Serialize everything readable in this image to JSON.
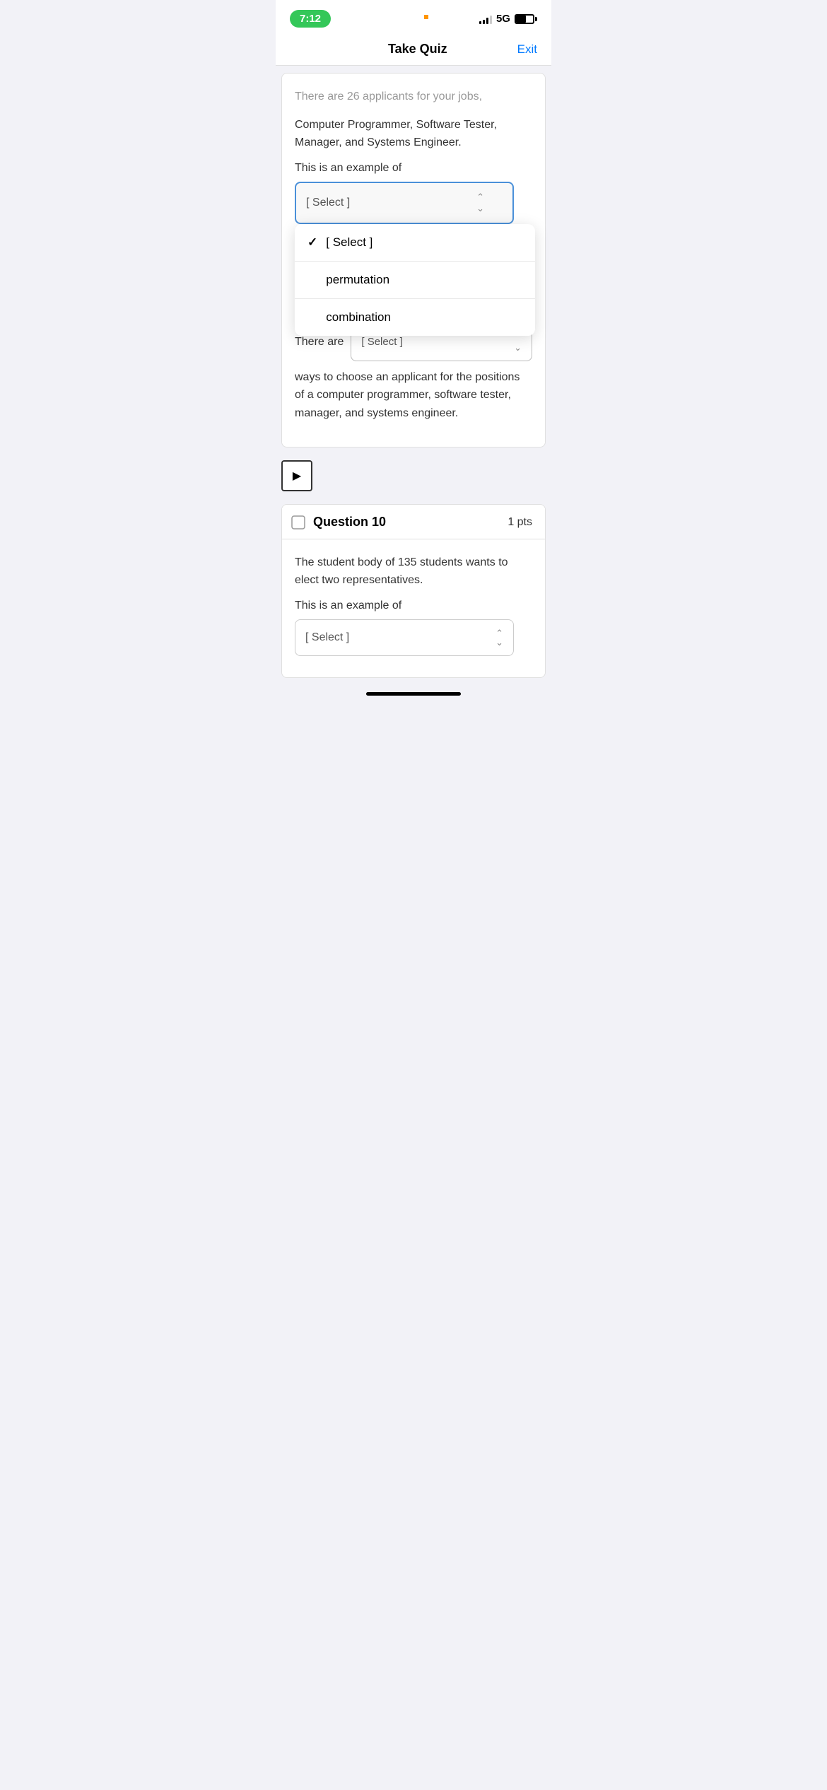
{
  "statusBar": {
    "time": "7:12",
    "network": "5G"
  },
  "header": {
    "title": "Take Quiz",
    "exitLabel": "Exit"
  },
  "question9": {
    "bodyText1": "Computer Programmer, Software Tester, Manager, and Systems Engineer.",
    "labelText": "This is an example of",
    "dropdownPlaceholder": "[ Select ]",
    "dropdownItems": [
      {
        "label": "[ Select ]",
        "selected": true
      },
      {
        "label": "permutation",
        "selected": false
      },
      {
        "label": "combination",
        "selected": false
      }
    ],
    "inlinePrefix": "There are",
    "inlinePlaceholder": "[ Select ]",
    "bodyText2": "ways to choose an applicant for the positions of a computer programmer, software tester, manager, and systems engineer."
  },
  "question10": {
    "number": "Question 10",
    "pts": "1 pts",
    "bodyText": "The student body of 135 students wants to elect two representatives.",
    "labelText": "This is an example of",
    "dropdownPlaceholder": "[ Select ]"
  },
  "icons": {
    "checkmark": "✓",
    "chevronUpDown": "⌃⌄",
    "chevronDouble": "⇅",
    "play": "▶",
    "bookmark": "⬜"
  }
}
